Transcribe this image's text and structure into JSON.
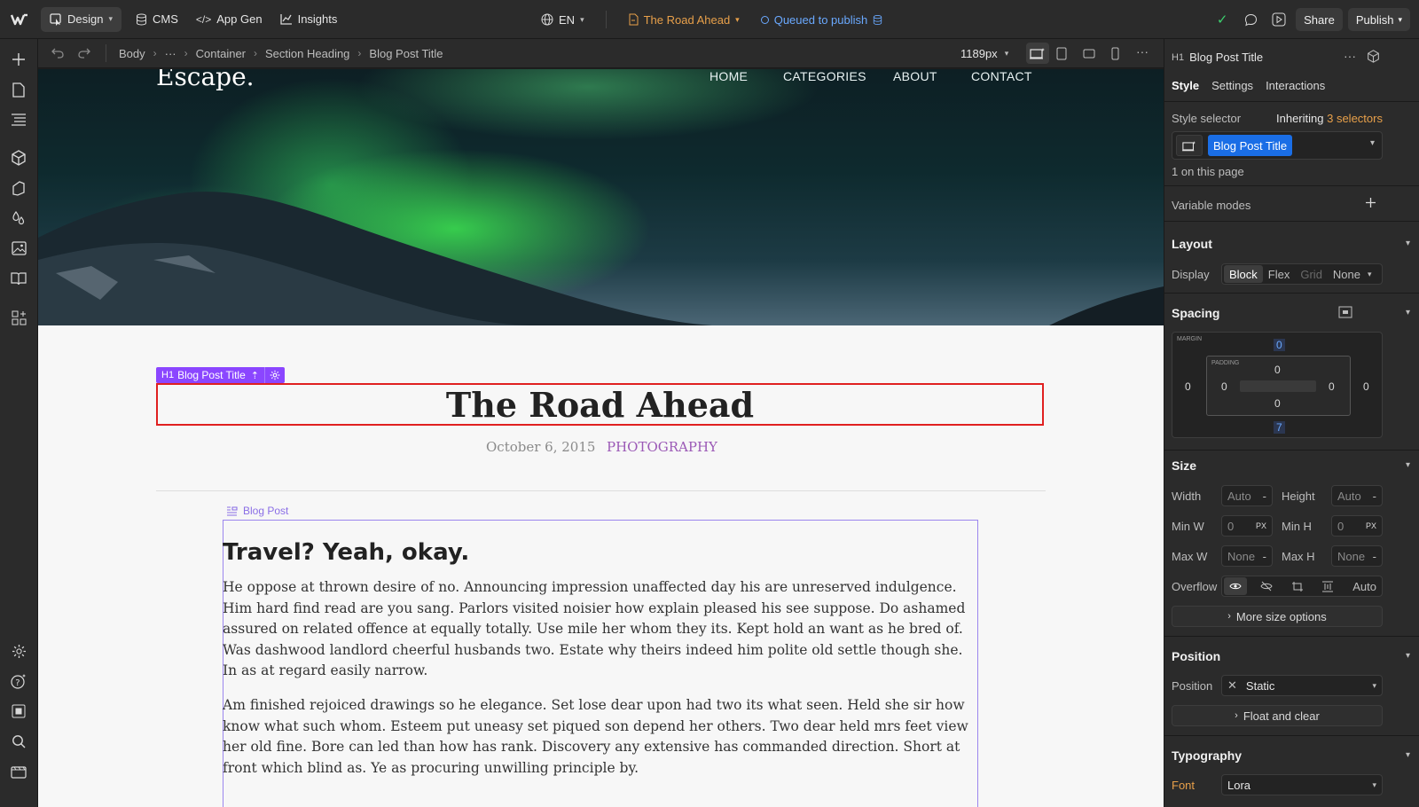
{
  "topbar": {
    "design_label": "Design",
    "cms_label": "CMS",
    "appgen_label": "App Gen",
    "insights_label": "Insights",
    "locale_label": "EN",
    "page_label": "The Road Ahead",
    "status_label": "Queued to publish",
    "share_label": "Share",
    "publish_label": "Publish"
  },
  "breadcrumb": {
    "items": [
      "Body",
      "···",
      "Container",
      "Section Heading",
      "Blog Post Title"
    ],
    "width_label": "1189px"
  },
  "canvas": {
    "site_logo": "Escape.",
    "nav": [
      "HOME",
      "CATEGORIES",
      "ABOUT",
      "CONTACT"
    ],
    "h1_tag_prefix": "H1",
    "h1_tag_label": "Blog Post Title",
    "post_title": "The Road Ahead",
    "post_date": "October 6, 2015",
    "post_category": "PHOTOGRAPHY",
    "richtext_tag": "Blog Post",
    "richtext_heading": "Travel? Yeah, okay.",
    "paragraph_1": "He oppose at thrown desire of no. Announcing impression unaffected day his are unreserved indulgence. Him hard find read are you sang. Parlors visited noisier how explain pleased his see suppose. Do ashamed assured on related offence at equally totally. Use mile her whom they its. Kept hold an want as he bred of. Was dashwood landlord cheerful husbands two. Estate why theirs indeed him polite old settle though she. In as at regard easily narrow.",
    "paragraph_2": "Am finished rejoiced drawings so he elegance. Set lose dear upon had two its what seen. Held she sir how know what such whom. Esteem put uneasy set piqued son depend her others. Two dear held mrs feet view her old fine. Bore can led than how has rank. Discovery any extensive has commanded direction. Short at front which blind as. Ye as procuring unwilling principle by."
  },
  "panel": {
    "element_prefix": "H1",
    "element_name": "Blog Post Title",
    "tabs": [
      "Style",
      "Settings",
      "Interactions"
    ],
    "style_selector_label": "Style selector",
    "inheriting_label": "Inheriting",
    "inheriting_count": "3 selectors",
    "selector_chip": "Blog Post Title",
    "on_page": "1 on this page",
    "variable_modes": "Variable modes",
    "layout_head": "Layout",
    "display_label": "Display",
    "display_options": [
      "Block",
      "Flex",
      "Grid",
      "None"
    ],
    "spacing_head": "Spacing",
    "margin_label": "MARGIN",
    "padding_label": "PADDING",
    "margin": {
      "top": "0",
      "right": "0",
      "bottom": "7",
      "left": "0"
    },
    "padding": {
      "top": "0",
      "right": "0",
      "bottom": "0",
      "left": "0"
    },
    "size_head": "Size",
    "width_label": "Width",
    "width_value": "Auto",
    "height_label": "Height",
    "height_value": "Auto",
    "minw_label": "Min W",
    "minw_value": "0",
    "minh_label": "Min H",
    "minh_value": "0",
    "unit_px": "PX",
    "maxw_label": "Max W",
    "maxw_value": "None",
    "maxh_label": "Max H",
    "maxh_value": "None",
    "overflow_label": "Overflow",
    "overflow_auto": "Auto",
    "more_size": "More size options",
    "position_head": "Position",
    "position_label": "Position",
    "position_value": "Static",
    "float_clear": "Float and clear",
    "typography_head": "Typography",
    "font_label": "Font",
    "font_value": "Lora"
  },
  "colors": {
    "accent_purple": "#8b46ff",
    "selection_red": "#e02020",
    "chip_blue": "#1a6ee6",
    "status_blue": "#6aa9ff",
    "page_orange": "#e8a04a",
    "category_purple": "#9b59b6"
  }
}
